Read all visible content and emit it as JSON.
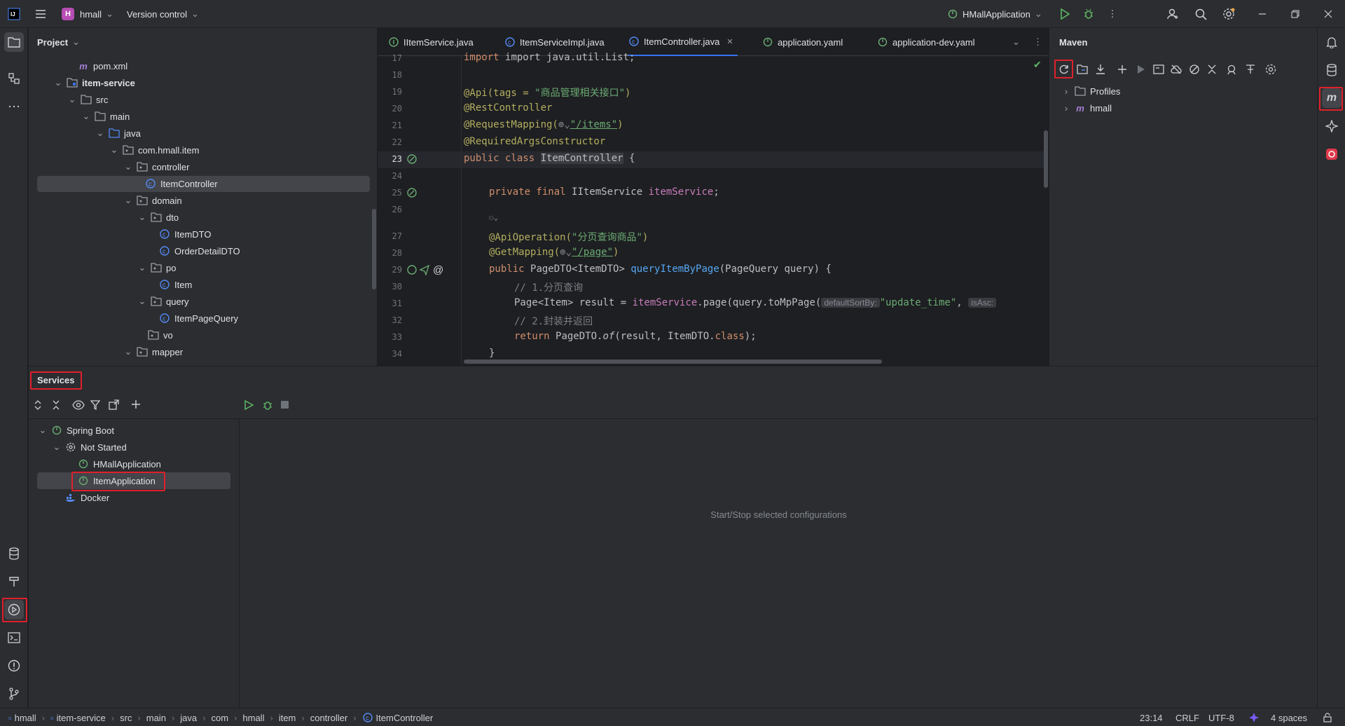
{
  "titlebar": {
    "project_badge": "H",
    "project_name": "hmall",
    "vcs_label": "Version control",
    "run_config": "HMallApplication"
  },
  "project_panel": {
    "title": "Project",
    "tree": [
      {
        "label": "pom.xml",
        "icon": "maven-icon"
      },
      {
        "label": "item-service",
        "icon": "module-folder-icon"
      },
      {
        "label": "src",
        "icon": "folder-icon"
      },
      {
        "label": "main",
        "icon": "folder-icon"
      },
      {
        "label": "java",
        "icon": "source-folder-icon"
      },
      {
        "label": "com.hmall.item",
        "icon": "package-icon"
      },
      {
        "label": "controller",
        "icon": "package-icon"
      },
      {
        "label": "ItemController",
        "icon": "class-icon"
      },
      {
        "label": "domain",
        "icon": "package-icon"
      },
      {
        "label": "dto",
        "icon": "package-icon"
      },
      {
        "label": "ItemDTO",
        "icon": "class-icon"
      },
      {
        "label": "OrderDetailDTO",
        "icon": "class-icon"
      },
      {
        "label": "po",
        "icon": "package-icon"
      },
      {
        "label": "Item",
        "icon": "class-icon"
      },
      {
        "label": "query",
        "icon": "package-icon"
      },
      {
        "label": "ItemPageQuery",
        "icon": "class-icon"
      },
      {
        "label": "vo",
        "icon": "package-icon"
      },
      {
        "label": "mapper",
        "icon": "package-icon"
      }
    ]
  },
  "editor": {
    "tabs": [
      {
        "label": "IItemService.java"
      },
      {
        "label": "ItemServiceImpl.java"
      },
      {
        "label": "ItemController.java"
      },
      {
        "label": "application.yaml"
      },
      {
        "label": "application-dev.yaml"
      }
    ],
    "line_numbers": [
      "17",
      "18",
      "19",
      "20",
      "21",
      "22",
      "23",
      "24",
      "25",
      "26",
      "27",
      "28",
      "29",
      "30",
      "31",
      "32",
      "33",
      "34"
    ],
    "code": {
      "l17": "import java.util.List;",
      "l19_ann": "@Api(tags = ",
      "l19_str": "\"商品管理相关接口\"",
      "l19_end": ")",
      "l20": "@RestController",
      "l21_ann": "@RequestMapping(",
      "l21_str": "\"/items\"",
      "l21_end": ")",
      "l22": "@RequiredArgsConstructor",
      "l23_kw": "public class ",
      "l23_cls": "ItemController",
      "l23_end": " {",
      "l25_kw": "private final ",
      "l25_type": "IItemService ",
      "l25_field": "itemService",
      "l25_end": ";",
      "l27_ann": "@ApiOperation(",
      "l27_str": "\"分页查询商品\"",
      "l27_end": ")",
      "l28_ann": "@GetMapping(",
      "l28_str": "\"/page\"",
      "l28_end": ")",
      "l29_kw": "public ",
      "l29_type": "PageDTO<ItemDTO> ",
      "l29_fn": "queryItemByPage",
      "l29_end": "(PageQuery query) {",
      "l30": "// 1.分页查询",
      "l31_a": "Page<Item> result = ",
      "l31_field": "itemService",
      "l31_b": ".page(query.toMpPage(",
      "l31_hint1": "defaultSortBy:",
      "l31_str": "\"update_time\"",
      "l31_c": ", ",
      "l31_hint2": "isAsc:",
      "l32": "// 2.封装并返回",
      "l33_kw": "return ",
      "l33_a": "PageDTO.",
      "l33_of": "of",
      "l33_b": "(result, ItemDTO.",
      "l33_class": "class",
      "l33_c": ");",
      "l34": "}"
    }
  },
  "maven": {
    "title": "Maven",
    "items": [
      {
        "label": "Profiles"
      },
      {
        "label": "hmall"
      }
    ]
  },
  "services": {
    "title": "Services",
    "tree": [
      {
        "label": "Spring Boot"
      },
      {
        "label": "Not Started"
      },
      {
        "label": "HMallApplication"
      },
      {
        "label": "ItemApplication"
      },
      {
        "label": "Docker"
      }
    ],
    "empty_hint": "Start/Stop selected configurations"
  },
  "statusbar": {
    "breadcrumbs": [
      "hmall",
      "item-service",
      "src",
      "main",
      "java",
      "com",
      "hmall",
      "item",
      "controller",
      "ItemController"
    ],
    "position": "23:14",
    "line_ending": "CRLF",
    "encoding": "UTF-8",
    "indent": "4 spaces"
  },
  "colors": {
    "accent": "#3574f0",
    "highlight_box": "#e0202c",
    "run_green": "#5fb865"
  }
}
